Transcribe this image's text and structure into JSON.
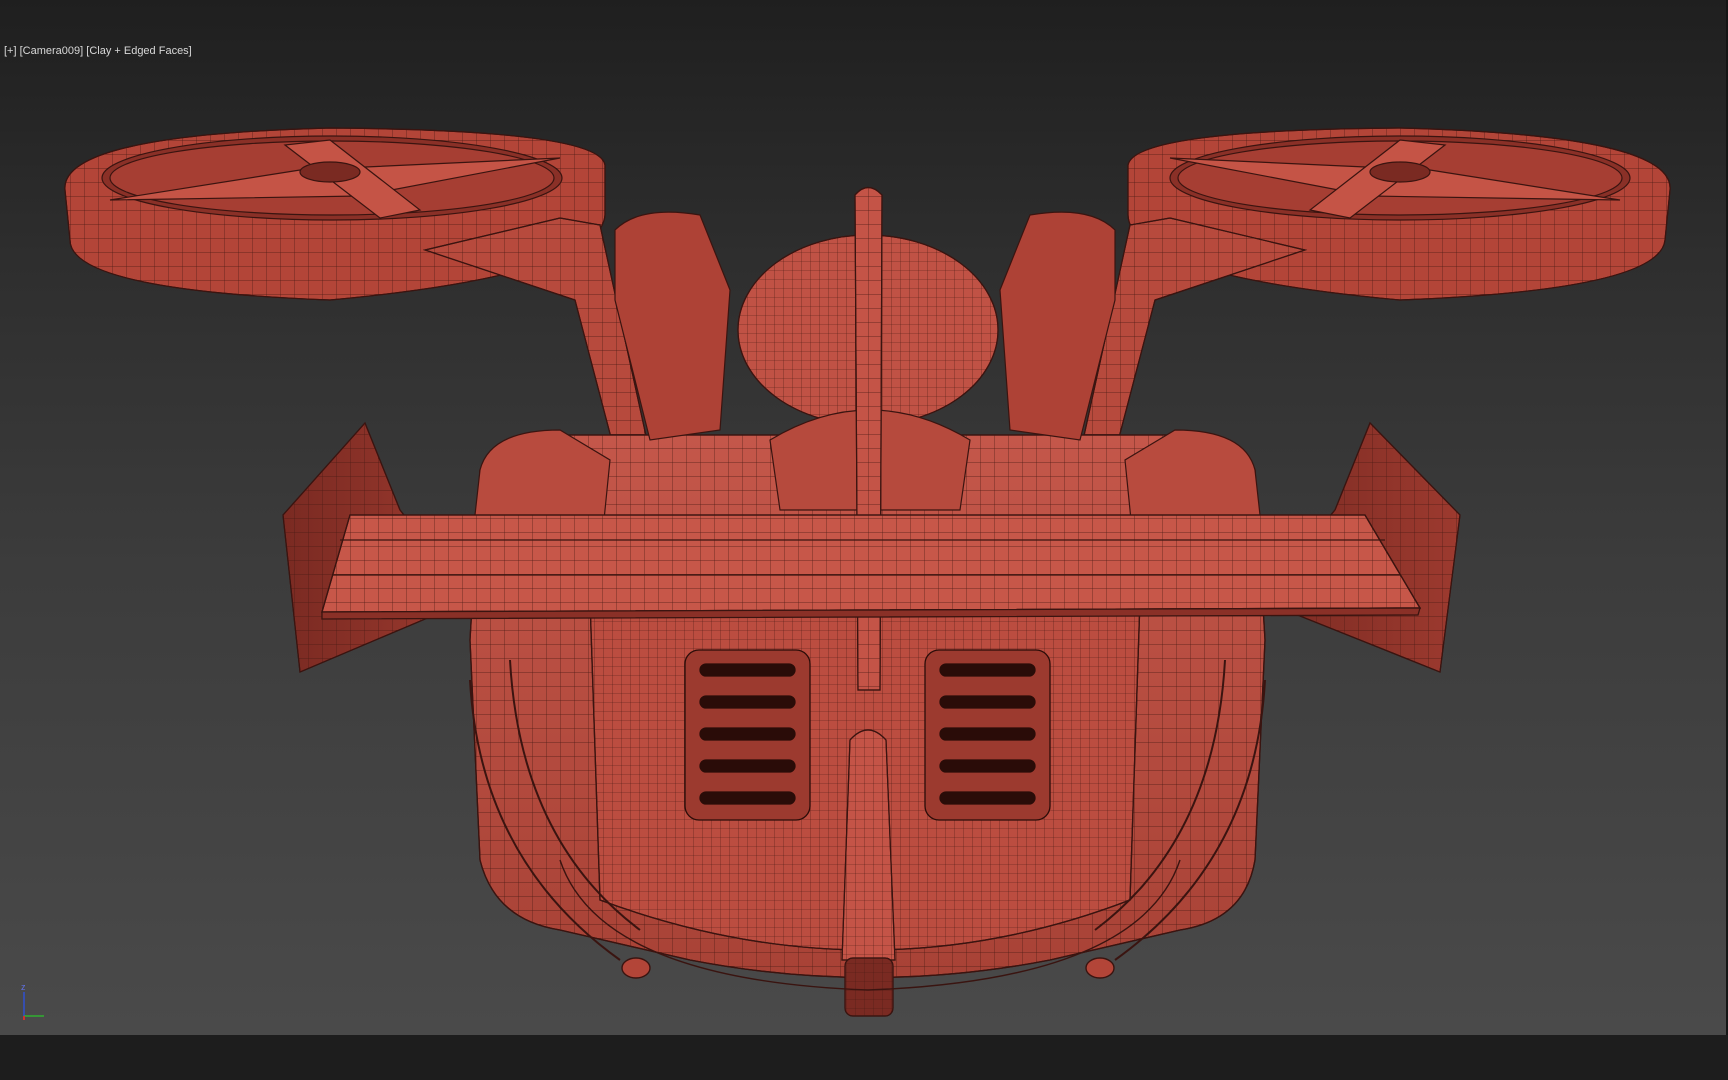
{
  "viewport": {
    "label": {
      "menu": "[+]",
      "camera": "[Camera009]",
      "shading": "[Clay + Edged Faces]"
    },
    "background_colors": [
      "#1f1f1f",
      "#4a4a4a"
    ],
    "model_color": "#c14c40",
    "wire_color": "#3a1410"
  },
  "axis_gizmo": {
    "z_label": "z",
    "x_color": "#d03030",
    "y_color": "#30b030",
    "z_color": "#3050d0"
  }
}
